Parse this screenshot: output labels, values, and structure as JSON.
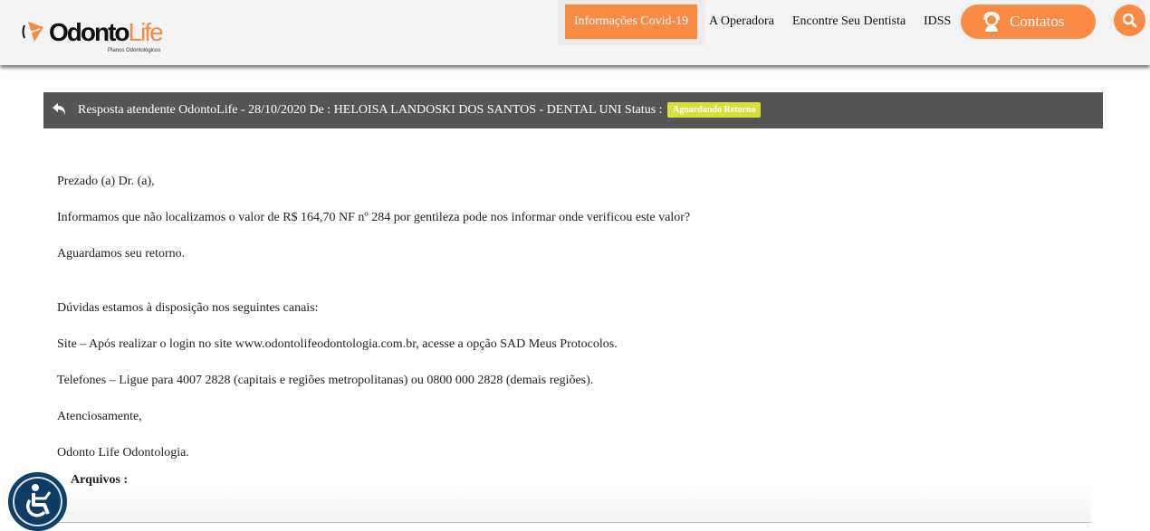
{
  "header": {
    "logo": {
      "name": "OdontoLife",
      "tagline": "Planos Odontológicos"
    },
    "nav": {
      "covid": "Informações Covid-19",
      "operadora": "A Operadora",
      "dentista": "Encontre Seu Dentista",
      "idss": "IDSS",
      "contatos": "Contatos"
    }
  },
  "ticket": {
    "title": "Resposta atendente OdontoLife - 28/10/2020 De : HELOISA LANDOSKI DOS SANTOS - DENTAL UNI Status :",
    "status": "Aguardando Retorno"
  },
  "message": [
    "Prezado (a) Dr. (a),",
    "Informamos que não localizamos o valor de R$ 164,70 NF nº 284 por gentileza pode nos informar onde verificou este valor?",
    "Aguardamos seu retorno.",
    "Dúvidas estamos à disposição nos seguintes canais:",
    "Site – Após realizar o login no site www.odontolifeodontologia.com.br, acesse a opção SAD Meus Protocolos.",
    "Telefones – Ligue para 4007 2828 (capitais e regiões metropolitanas) ou 0800 000 2828 (demais regiões).",
    "Atenciosamente,",
    "Odonto Life Odontologia."
  ],
  "files_label": "Arquivos :",
  "colors": {
    "accent": "#f98a44",
    "bar": "#555555",
    "badge": "#d7df3a",
    "accessibility": "#0d3d66"
  }
}
